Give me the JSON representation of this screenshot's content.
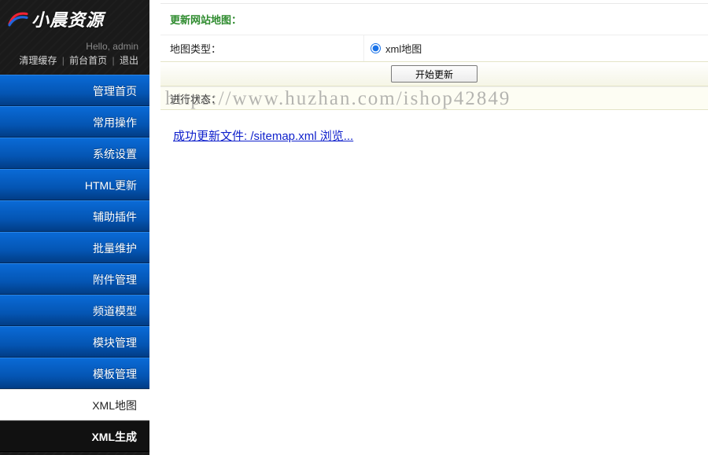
{
  "brand": {
    "name": "小晨资源"
  },
  "greeting": "Hello, admin",
  "top_links": {
    "clear_cache": "清理缓存",
    "front_home": "前台首页",
    "logout": "退出"
  },
  "sidebar": {
    "items": [
      {
        "label": "管理首页",
        "kind": "blue"
      },
      {
        "label": "常用操作",
        "kind": "blue"
      },
      {
        "label": "系统设置",
        "kind": "blue"
      },
      {
        "label": "HTML更新",
        "kind": "blue"
      },
      {
        "label": "辅助插件",
        "kind": "blue"
      },
      {
        "label": "批量维护",
        "kind": "blue"
      },
      {
        "label": "附件管理",
        "kind": "blue"
      },
      {
        "label": "频道模型",
        "kind": "blue"
      },
      {
        "label": "模块管理",
        "kind": "blue"
      },
      {
        "label": "模板管理",
        "kind": "blue"
      },
      {
        "label": "XML地图",
        "kind": "light"
      },
      {
        "label": "XML生成",
        "kind": "active"
      }
    ]
  },
  "main": {
    "section_title": "更新网站地图：",
    "type_label": "地图类型：",
    "type_option": "xml地图",
    "start_button": "开始更新",
    "status_label": "进行状态：",
    "result_link_text": "成功更新文件: /sitemap.xml 浏览..."
  },
  "watermark": "https://www.huzhan.com/ishop42849"
}
